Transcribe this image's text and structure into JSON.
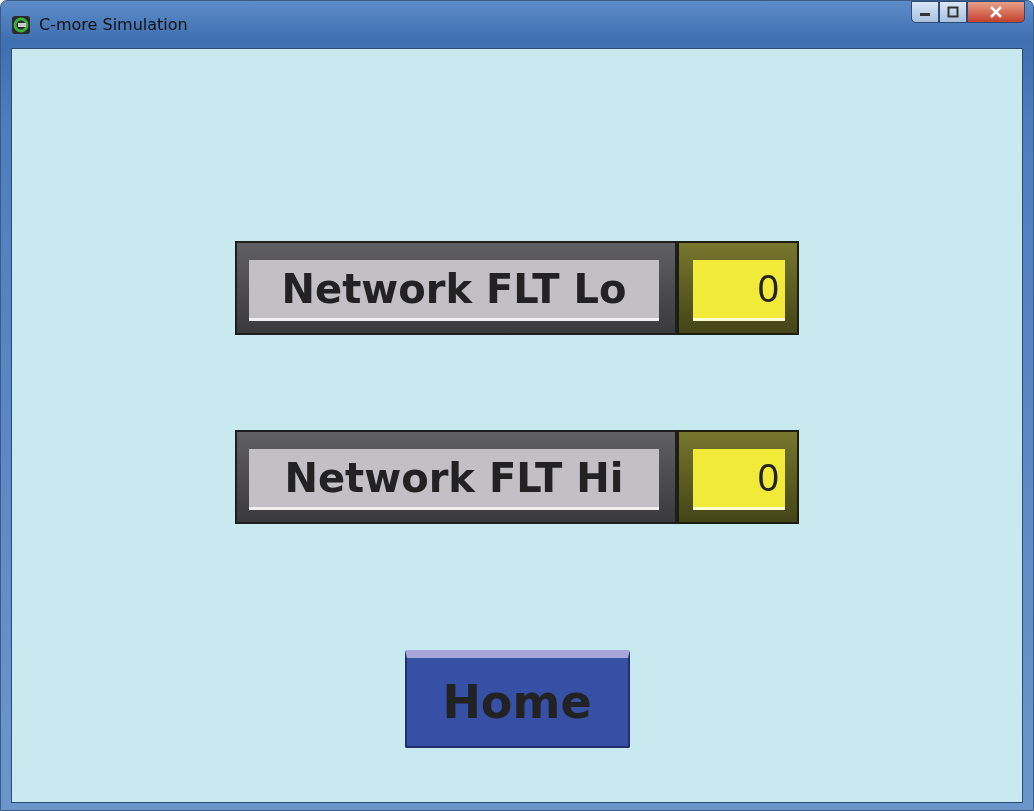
{
  "window": {
    "title": "C-more Simulation"
  },
  "displays": [
    {
      "label": "Network FLT Lo",
      "value": "0"
    },
    {
      "label": "Network FLT Hi",
      "value": "0"
    }
  ],
  "home_button": {
    "label": "Home"
  }
}
